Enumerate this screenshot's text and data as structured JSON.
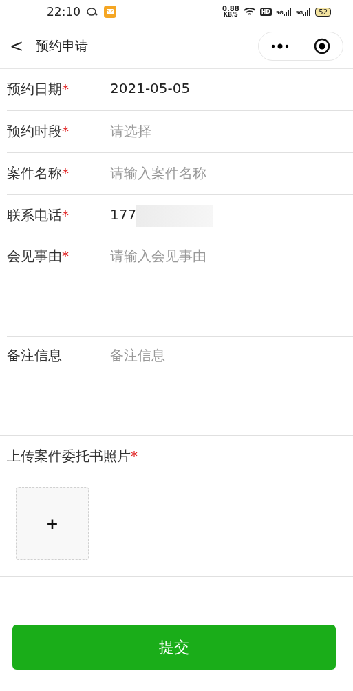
{
  "status_bar": {
    "time": "22:10",
    "speed": "0.88",
    "speed_unit": "KB/S",
    "hd": "HD",
    "signals": [
      "5G",
      "5G"
    ],
    "battery": "52"
  },
  "nav": {
    "title": "预约申请",
    "back": "<"
  },
  "fields": [
    {
      "kind": "line",
      "label": "预约日期",
      "mark": "*",
      "value": "2021-05-05"
    },
    {
      "kind": "line",
      "label": "预约时段",
      "mark": "*",
      "placeholder": "请选择"
    },
    {
      "kind": "line",
      "label": "案件名称",
      "mark": "*",
      "placeholder": "请输入案件名称"
    },
    {
      "kind": "redacted",
      "label": "联系电话",
      "mark": "*",
      "value": "177"
    },
    {
      "kind": "area",
      "label": "会见事由",
      "mark": "*",
      "placeholder": "请输入会见事由"
    },
    {
      "kind": "area",
      "label": "备注信息",
      "placeholder": "备注信息"
    }
  ],
  "upload": {
    "label": "上传案件委托书照片",
    "mark": "*",
    "add": "+"
  },
  "submit": "提交"
}
